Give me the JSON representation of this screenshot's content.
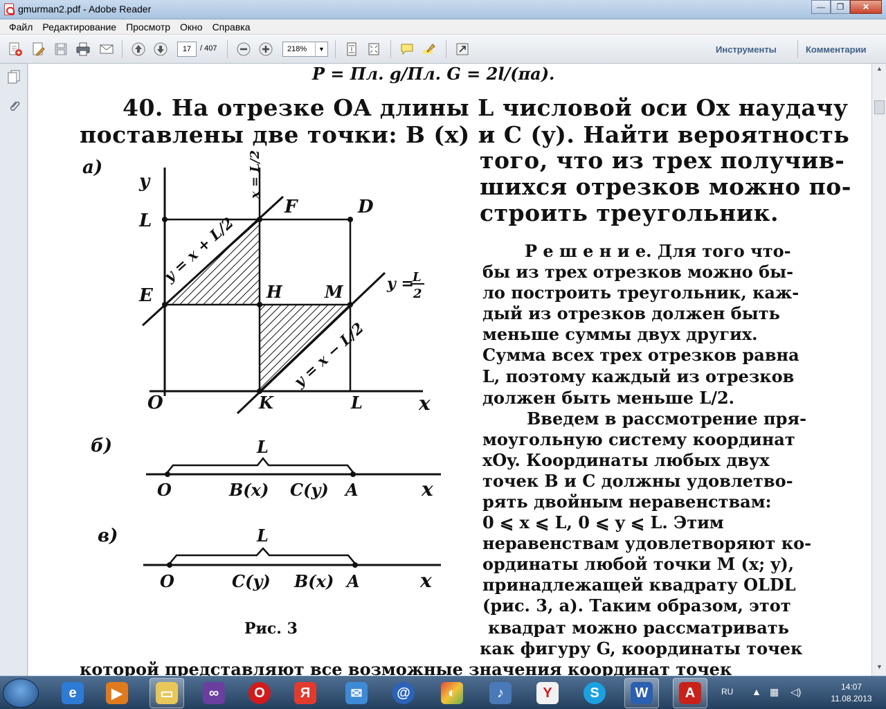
{
  "window": {
    "title": "gmurman2.pdf - Adobe Reader",
    "controls": {
      "minimize": "—",
      "maximize": "❐",
      "close": "✕"
    }
  },
  "menu": [
    "Файл",
    "Редактирование",
    "Просмотр",
    "Окно",
    "Справка"
  ],
  "toolbar": {
    "page_current": "17",
    "page_total": "/ 407",
    "zoom": "218%",
    "tools_label": "Инструменты",
    "comments_label": "Комментарии"
  },
  "doc": {
    "top_formula": "P = Пл. g/Пл. G = 2l/(πa).",
    "problem_line1": "40.  На  отрезке  OA  длины  L  числовой  оси  Ox  наудачу",
    "problem_line2": "поставлены  две  точки:  B (x)  и  C (y).  Найти  вероятность",
    "right_lines": [
      "того, что из трех получив-",
      "шихся отрезков можно по-",
      "строить треугольник."
    ],
    "solution_lines": [
      "Р е ш е н и е.  Для того что-",
      "бы из трех отрезков можно бы-",
      "ло построить треугольник, каж-",
      "дый  из  отрезков  должен  быть",
      "меньше  суммы   двух  других.",
      "Сумма всех трех отрезков равна",
      "L, поэтому каждый из отрезков",
      "должен быть меньше L/2.",
      "Введем в рассмотрение пря-",
      "моугольную  систему координат",
      "xOy.  Координаты любых  двух",
      "точек B и C должны удовлетво-",
      "рять   двойным   неравенствам:",
      "0 ⩽ x ⩽ L,     0 ⩽ y ⩽ L.   Этим",
      "неравенствам удовлетворяют ко-",
      "ординаты  любой точки M (x; y),",
      "принадлежащей квадрату OLDL",
      "(рис. 3, a).  Таким образом, этот",
      "квадрат  можно  рассматривать",
      "как фигуру G, координаты точек"
    ],
    "bottom_line": "которой  представляют  все  возможные  значения  координат  точек",
    "figure": {
      "caption": "Рис. 3",
      "label_a": "а)",
      "label_b": "б)",
      "label_c": "в)",
      "axis_y": "y",
      "axis_x": "x",
      "pt_L": "L",
      "pt_E": "E",
      "pt_O": "O",
      "pt_K": "K",
      "pt_Lx": "L",
      "pt_F": "F",
      "pt_D": "D",
      "pt_H": "H",
      "pt_M": "M",
      "x_eq": "x = L/2",
      "line1": "y = x + L/2",
      "line2": "y = x − L/2",
      "y_eq_num": "L",
      "y_eq_den": "2",
      "y_eq_prefix": "y =",
      "b_L": "L",
      "b_O": "O",
      "b_B": "B(x)",
      "b_C": "C(y)",
      "b_A": "A",
      "b_x": "x",
      "c_L": "L",
      "c_O": "O",
      "c_C": "C(y)",
      "c_B": "B(x)",
      "c_A": "A",
      "c_x": "x"
    }
  },
  "taskbar": {
    "lang": "RU",
    "time": "14:07",
    "date": "11.08.2013",
    "apps": [
      "ie",
      "media",
      "explorer",
      "vs",
      "opera",
      "yandex",
      "mail",
      "mailru",
      "color",
      "volume",
      "browser",
      "skype",
      "word",
      "acrobat"
    ]
  }
}
